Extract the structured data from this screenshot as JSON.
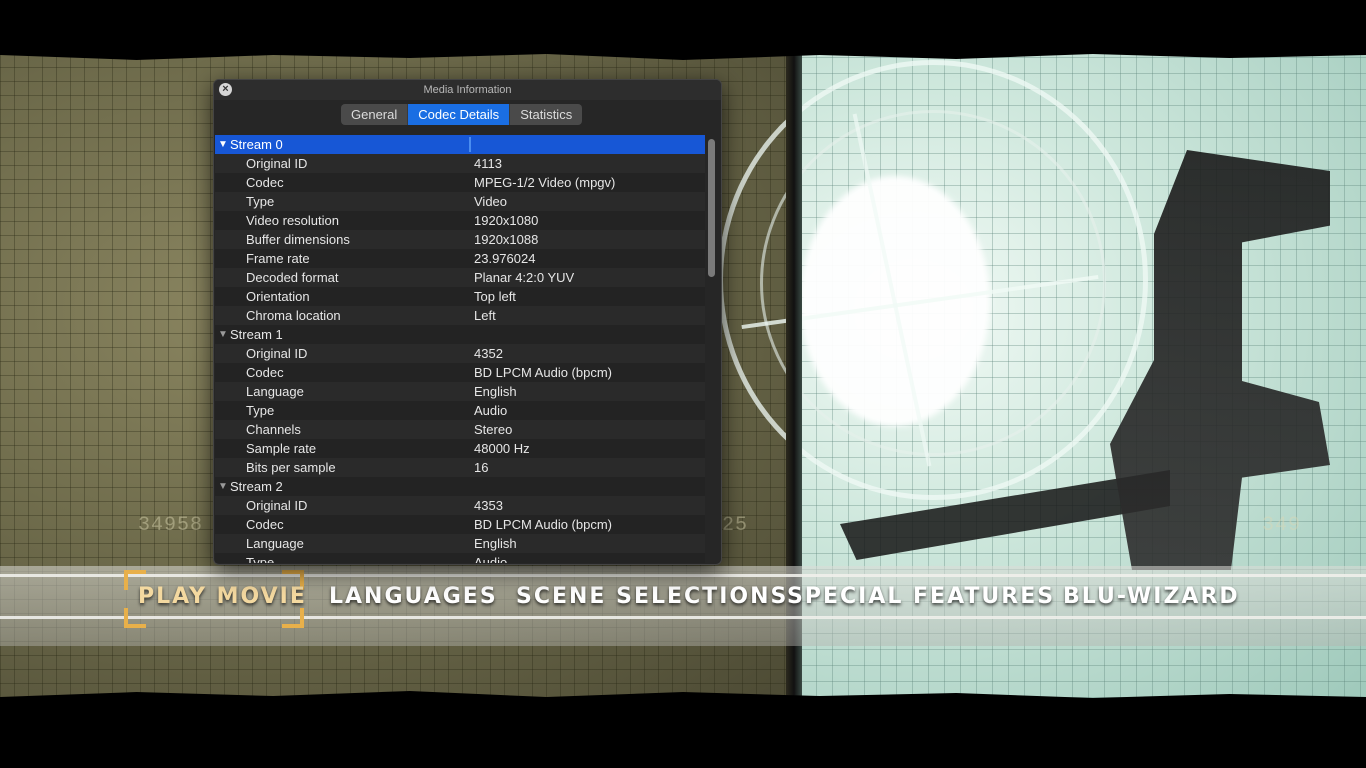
{
  "window": {
    "title": "Media Information",
    "close_icon": "close-icon"
  },
  "tabs": [
    {
      "label": "General",
      "selected": false
    },
    {
      "label": "Codec Details",
      "selected": true
    },
    {
      "label": "Statistics",
      "selected": false
    }
  ],
  "streams": [
    {
      "title": "Stream 0",
      "expanded": true,
      "rows": [
        {
          "key": "Original ID",
          "value": "4113"
        },
        {
          "key": "Codec",
          "value": "MPEG-1/2 Video (mpgv)"
        },
        {
          "key": "Type",
          "value": "Video"
        },
        {
          "key": "Video resolution",
          "value": "1920x1080"
        },
        {
          "key": "Buffer dimensions",
          "value": "1920x1088"
        },
        {
          "key": "Frame rate",
          "value": "23.976024"
        },
        {
          "key": "Decoded format",
          "value": "Planar 4:2:0 YUV"
        },
        {
          "key": "Orientation",
          "value": "Top left"
        },
        {
          "key": "Chroma location",
          "value": "Left"
        }
      ]
    },
    {
      "title": "Stream 1",
      "expanded": true,
      "rows": [
        {
          "key": "Original ID",
          "value": "4352"
        },
        {
          "key": "Codec",
          "value": "BD LPCM Audio (bpcm)"
        },
        {
          "key": "Language",
          "value": "English"
        },
        {
          "key": "Type",
          "value": "Audio"
        },
        {
          "key": "Channels",
          "value": "Stereo"
        },
        {
          "key": "Sample rate",
          "value": "48000 Hz"
        },
        {
          "key": "Bits per sample",
          "value": "16"
        }
      ]
    },
    {
      "title": "Stream 2",
      "expanded": true,
      "rows": [
        {
          "key": "Original ID",
          "value": "4353"
        },
        {
          "key": "Codec",
          "value": "BD LPCM Audio (bpcm)"
        },
        {
          "key": "Language",
          "value": "English"
        },
        {
          "key": "Type",
          "value": "Audio"
        }
      ]
    }
  ],
  "menu": {
    "items": [
      "PLAY MOVIE",
      "LANGUAGES",
      "SCENE SELECTIONS",
      "SPECIAL FEATURES",
      "BLU-WIZARD"
    ],
    "active": "PLAY MOVIE",
    "active_color": "#f4d9a0",
    "focus_color": "#e8b04a"
  },
  "background": {
    "numbers_left": "34958",
    "numbers_mid": "25",
    "numbers_right": "349"
  },
  "colors": {
    "selection": "#1757d6",
    "tab_selected": "#1a6ee3"
  }
}
